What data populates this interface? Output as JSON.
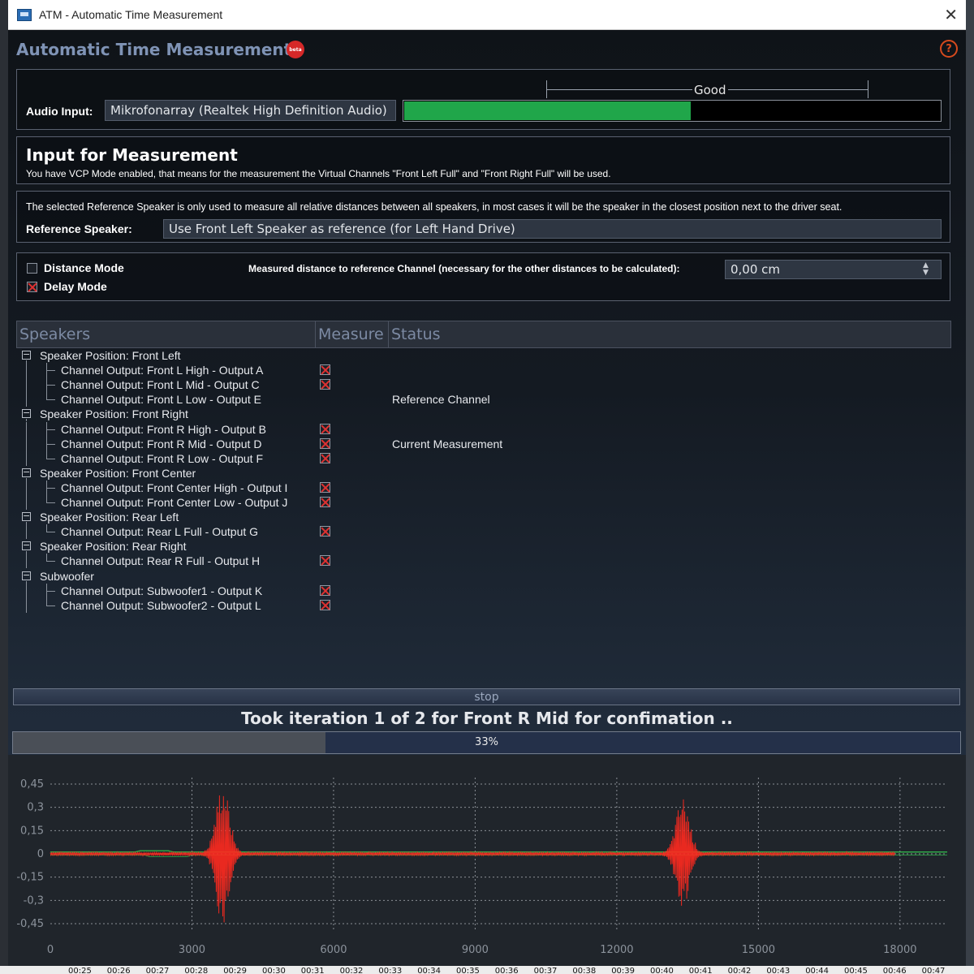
{
  "window": {
    "title": "ATM - Automatic Time Measurement",
    "close_glyph": "✕"
  },
  "header": {
    "app_title": "Automatic Time Measurement",
    "badge": "beta",
    "help_glyph": "?"
  },
  "audio": {
    "label": "Audio Input:",
    "device": "Mikrofonarray (Realtek High Definition Audio)",
    "level_label": "Good",
    "level_fraction": 0.535,
    "level_color": "#20a64a"
  },
  "input_section": {
    "title": "Input for Measurement",
    "description": "You have VCP Mode enabled, that means for the measurement the Virtual Channels \"Front Left Full\" and \"Front Right Full\" will be used."
  },
  "reference": {
    "note": "The selected Reference Speaker is only used to measure all relative distances between all speakers, in most cases it will be the speaker in the closest position next to the driver seat.",
    "label": "Reference Speaker:",
    "value": "Use Front Left Speaker as reference (for Left Hand Drive)"
  },
  "modes": {
    "distance_label": "Distance Mode",
    "distance_checked": false,
    "delay_label": "Delay Mode",
    "delay_checked": true,
    "distance_field_label": "Measured distance to reference Channel (necessary for the other distances to be calculated):",
    "distance_value": "0,00 cm",
    "spin_up": "▲",
    "spin_down": "▼"
  },
  "table": {
    "columns": [
      "Speakers",
      "Measure",
      "Status"
    ],
    "rows": [
      {
        "level": 0,
        "text": "Speaker Position: Front Left",
        "measure": false,
        "status": ""
      },
      {
        "level": 1,
        "text": "Channel Output: Front L High - Output A",
        "measure": true,
        "status": ""
      },
      {
        "level": 1,
        "text": "Channel Output: Front L Mid - Output C",
        "measure": true,
        "status": ""
      },
      {
        "level": 1,
        "text": "Channel Output: Front L Low - Output E",
        "measure": false,
        "status": "Reference Channel"
      },
      {
        "level": 0,
        "text": "Speaker Position: Front Right",
        "measure": false,
        "status": ""
      },
      {
        "level": 1,
        "text": "Channel Output: Front R High - Output B",
        "measure": true,
        "status": ""
      },
      {
        "level": 1,
        "text": "Channel Output: Front R Mid - Output D",
        "measure": true,
        "status": "Current Measurement"
      },
      {
        "level": 1,
        "text": "Channel Output: Front R Low - Output F",
        "measure": true,
        "status": ""
      },
      {
        "level": 0,
        "text": "Speaker Position: Front Center",
        "measure": false,
        "status": ""
      },
      {
        "level": 1,
        "text": "Channel Output: Front Center High - Output I",
        "measure": true,
        "status": ""
      },
      {
        "level": 1,
        "text": "Channel Output: Front Center Low - Output J",
        "measure": true,
        "status": ""
      },
      {
        "level": 0,
        "text": "Speaker Position: Rear Left",
        "measure": false,
        "status": ""
      },
      {
        "level": 1,
        "text": "Channel Output: Rear L Full - Output G",
        "measure": true,
        "status": ""
      },
      {
        "level": 0,
        "text": "Speaker Position: Rear Right",
        "measure": false,
        "status": ""
      },
      {
        "level": 1,
        "text": "Channel Output: Rear R Full - Output H",
        "measure": true,
        "status": ""
      },
      {
        "level": 0,
        "text": "Subwoofer",
        "measure": false,
        "status": ""
      },
      {
        "level": 1,
        "text": "Channel Output: Subwoofer1 - Output K",
        "measure": true,
        "status": ""
      },
      {
        "level": 1,
        "text": "Channel Output: Subwoofer2 - Output L",
        "measure": true,
        "status": ""
      }
    ]
  },
  "controls": {
    "stop_label": "stop",
    "iteration_text": "Took iteration 1 of 2 for Front R Mid for confimation ..",
    "progress_fraction": 0.33,
    "progress_label": "33%"
  },
  "chart_data": {
    "type": "line",
    "ylim": [
      -0.45,
      0.45
    ],
    "xlim": [
      0,
      19000
    ],
    "yticks": [
      "0,45",
      "0,3",
      "0,15",
      "0",
      "-0,15",
      "-0,3",
      "-0,45"
    ],
    "ytick_values": [
      0.45,
      0.3,
      0.15,
      0,
      -0.15,
      -0.3,
      -0.45
    ],
    "xticks": [
      "0",
      "3000",
      "6000",
      "9000",
      "12000",
      "15000",
      "18000"
    ],
    "xtick_values": [
      0,
      3000,
      6000,
      9000,
      12000,
      15000,
      18000
    ],
    "grid": true,
    "series": [
      {
        "color": "#ff2a1f",
        "bursts": [
          {
            "center": 3650,
            "amplitude": 0.45
          },
          {
            "center": 13400,
            "amplitude": 0.36
          }
        ],
        "noise": 0.01
      },
      {
        "color": "#2fb34a",
        "baseline": 0.012
      }
    ]
  },
  "timeline": {
    "ticks": [
      "00:25",
      "00:26",
      "00:27",
      "00:28",
      "00:29",
      "00:30",
      "00:31",
      "00:32",
      "00:33",
      "00:34",
      "00:35",
      "00:36",
      "00:37",
      "00:38",
      "00:39",
      "00:40",
      "00:41",
      "00:42",
      "00:43",
      "00:44",
      "00:45",
      "00:46",
      "00:47"
    ]
  }
}
